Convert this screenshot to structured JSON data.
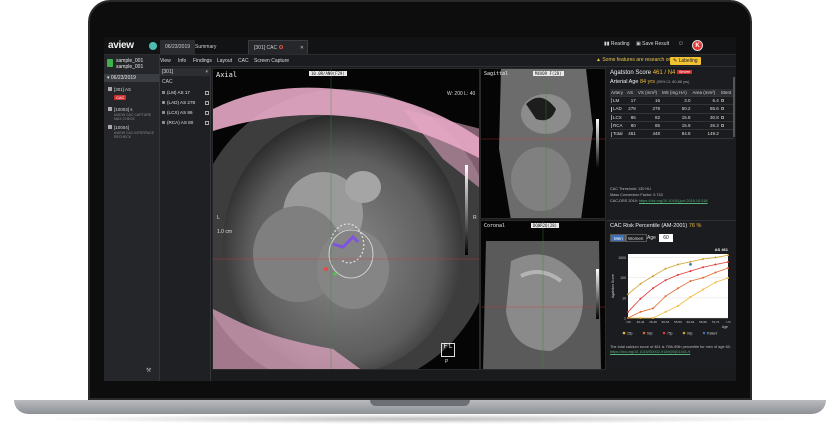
{
  "app": {
    "logo": "aview",
    "logo_sub": "",
    "tabs": {
      "date": "06/23/2019",
      "summary": "Summary",
      "cac": "[301] CAC"
    },
    "toolbar": {
      "reading": "Reading",
      "save": "Save Result",
      "avatar": "K"
    }
  },
  "sidebar": {
    "patient_line1": "sample_001",
    "patient_line2": "sample_001",
    "study_date": "06/23/2019",
    "series": [
      {
        "label": "[301] AS",
        "badge": "CAC"
      },
      {
        "label": "[10003] s",
        "sub": "AVIEW CAC CAPTURE MAX CHECK"
      },
      {
        "label": "[10004]",
        "sub": "AVIEW CAC INTERFACE RECHECK"
      }
    ]
  },
  "findings": {
    "header": "[301]",
    "sub": "CAC",
    "items": [
      {
        "label": "(LM) AS 17",
        "color": "#e04b4b"
      },
      {
        "label": "(LAD) AS 278",
        "color": "#f0b93a"
      },
      {
        "label": "(LCX) AS 86",
        "color": "#4cc94c"
      },
      {
        "label": "(RCA) AS 80",
        "color": "#b45be0"
      }
    ]
  },
  "menu": {
    "items": [
      "View",
      "Info",
      "Findings",
      "Layout",
      "CAC",
      "Screen Capture"
    ],
    "research": "Some features are research only",
    "labeling": "Labeling"
  },
  "viewers": {
    "axial": {
      "label": "Axial",
      "tag": "10.0R/AN9(F29)",
      "wl": "W: 200  L: 40",
      "scale": "1.0 cm",
      "orient_l": "L",
      "orient_r": "R",
      "orient_bottom": "P",
      "box": "F L"
    },
    "sagittal": {
      "label": "Sagittal",
      "tag": "M4X09 F(28)"
    },
    "coronal": {
      "label": "Coronal",
      "tag": "DQ0R2Q(28)"
    }
  },
  "agatston": {
    "title_prefix": "Agatston Score",
    "title_value": "461 / N4",
    "severity": "Severe",
    "age_label": "Arterial Age",
    "age_value": "84 yrs",
    "age_ci": "(95% CI: 80-88 yrs)",
    "columns": [
      "Artery",
      "AS",
      "VS (mm³)",
      "MS (mg HA)",
      "Area (mm²)",
      "Stent"
    ],
    "rows": [
      {
        "artery": "LM",
        "as": "17",
        "vs": "16",
        "ms": "3.0",
        "area": "6.4",
        "color": "#e04b4b"
      },
      {
        "artery": "LAD",
        "as": "278",
        "vs": "278",
        "ms": "50.2",
        "area": "85.6",
        "color": "#f0b93a"
      },
      {
        "artery": "LCX",
        "as": "86",
        "vs": "82",
        "ms": "15.8",
        "area": "30.8",
        "color": "#4cc94c"
      },
      {
        "artery": "RCA",
        "as": "80",
        "vs": "85",
        "ms": "15.9",
        "area": "26.3",
        "color": "#b45be0"
      },
      {
        "artery": "Total",
        "as": "461",
        "vs": "448",
        "ms": "84.8",
        "area": "149.2",
        "color": "#888888"
      }
    ],
    "note1": "CAC Threshold: 130 HU",
    "note2": "Mass Conversion Factor: 0.743",
    "note3": "CAC-DRS 2019",
    "link": "https://doi.org/10.1016/j.jcct.2018.10.018"
  },
  "risk": {
    "title_prefix": "CAC Risk Percentile (AM-2001)",
    "title_value": "76 %",
    "gender": [
      "Men",
      "Women"
    ],
    "age_label": "Age",
    "age_value": "60",
    "note": "The total calcium score of 461 is 75th-90th percentile for men of age 60.",
    "link": "https://doi.org/10.1016/S0002-9149(00)01441-9"
  },
  "chart_data": {
    "type": "line",
    "title": "AS 461",
    "xlabel": "Age",
    "ylabel": "Agatston Score",
    "log_scale_y": true,
    "categories": [
      "<40",
      "40-44",
      "45-49",
      "50-54",
      "55-59",
      "60-64",
      "65-69",
      "70-74",
      ">74"
    ],
    "series": [
      {
        "name": "25p",
        "color": "#f0b93a",
        "values": [
          1,
          1,
          1,
          2,
          4,
          11,
          26,
          59,
          98
        ]
      },
      {
        "name": "50p",
        "color": "#e0662e",
        "values": [
          1,
          2,
          3,
          12,
          30,
          68,
          100,
          180,
          300
        ]
      },
      {
        "name": "75p",
        "color": "#e03636",
        "values": [
          2,
          9,
          30,
          75,
          138,
          211,
          330,
          450,
          600
        ]
      },
      {
        "name": "90p",
        "color": "#cfa12a",
        "values": [
          15,
          50,
          120,
          280,
          450,
          620,
          850,
          1000,
          1300
        ]
      }
    ],
    "patient_point": {
      "x": "60-64",
      "y": 461
    },
    "patient_label": "Patient"
  }
}
